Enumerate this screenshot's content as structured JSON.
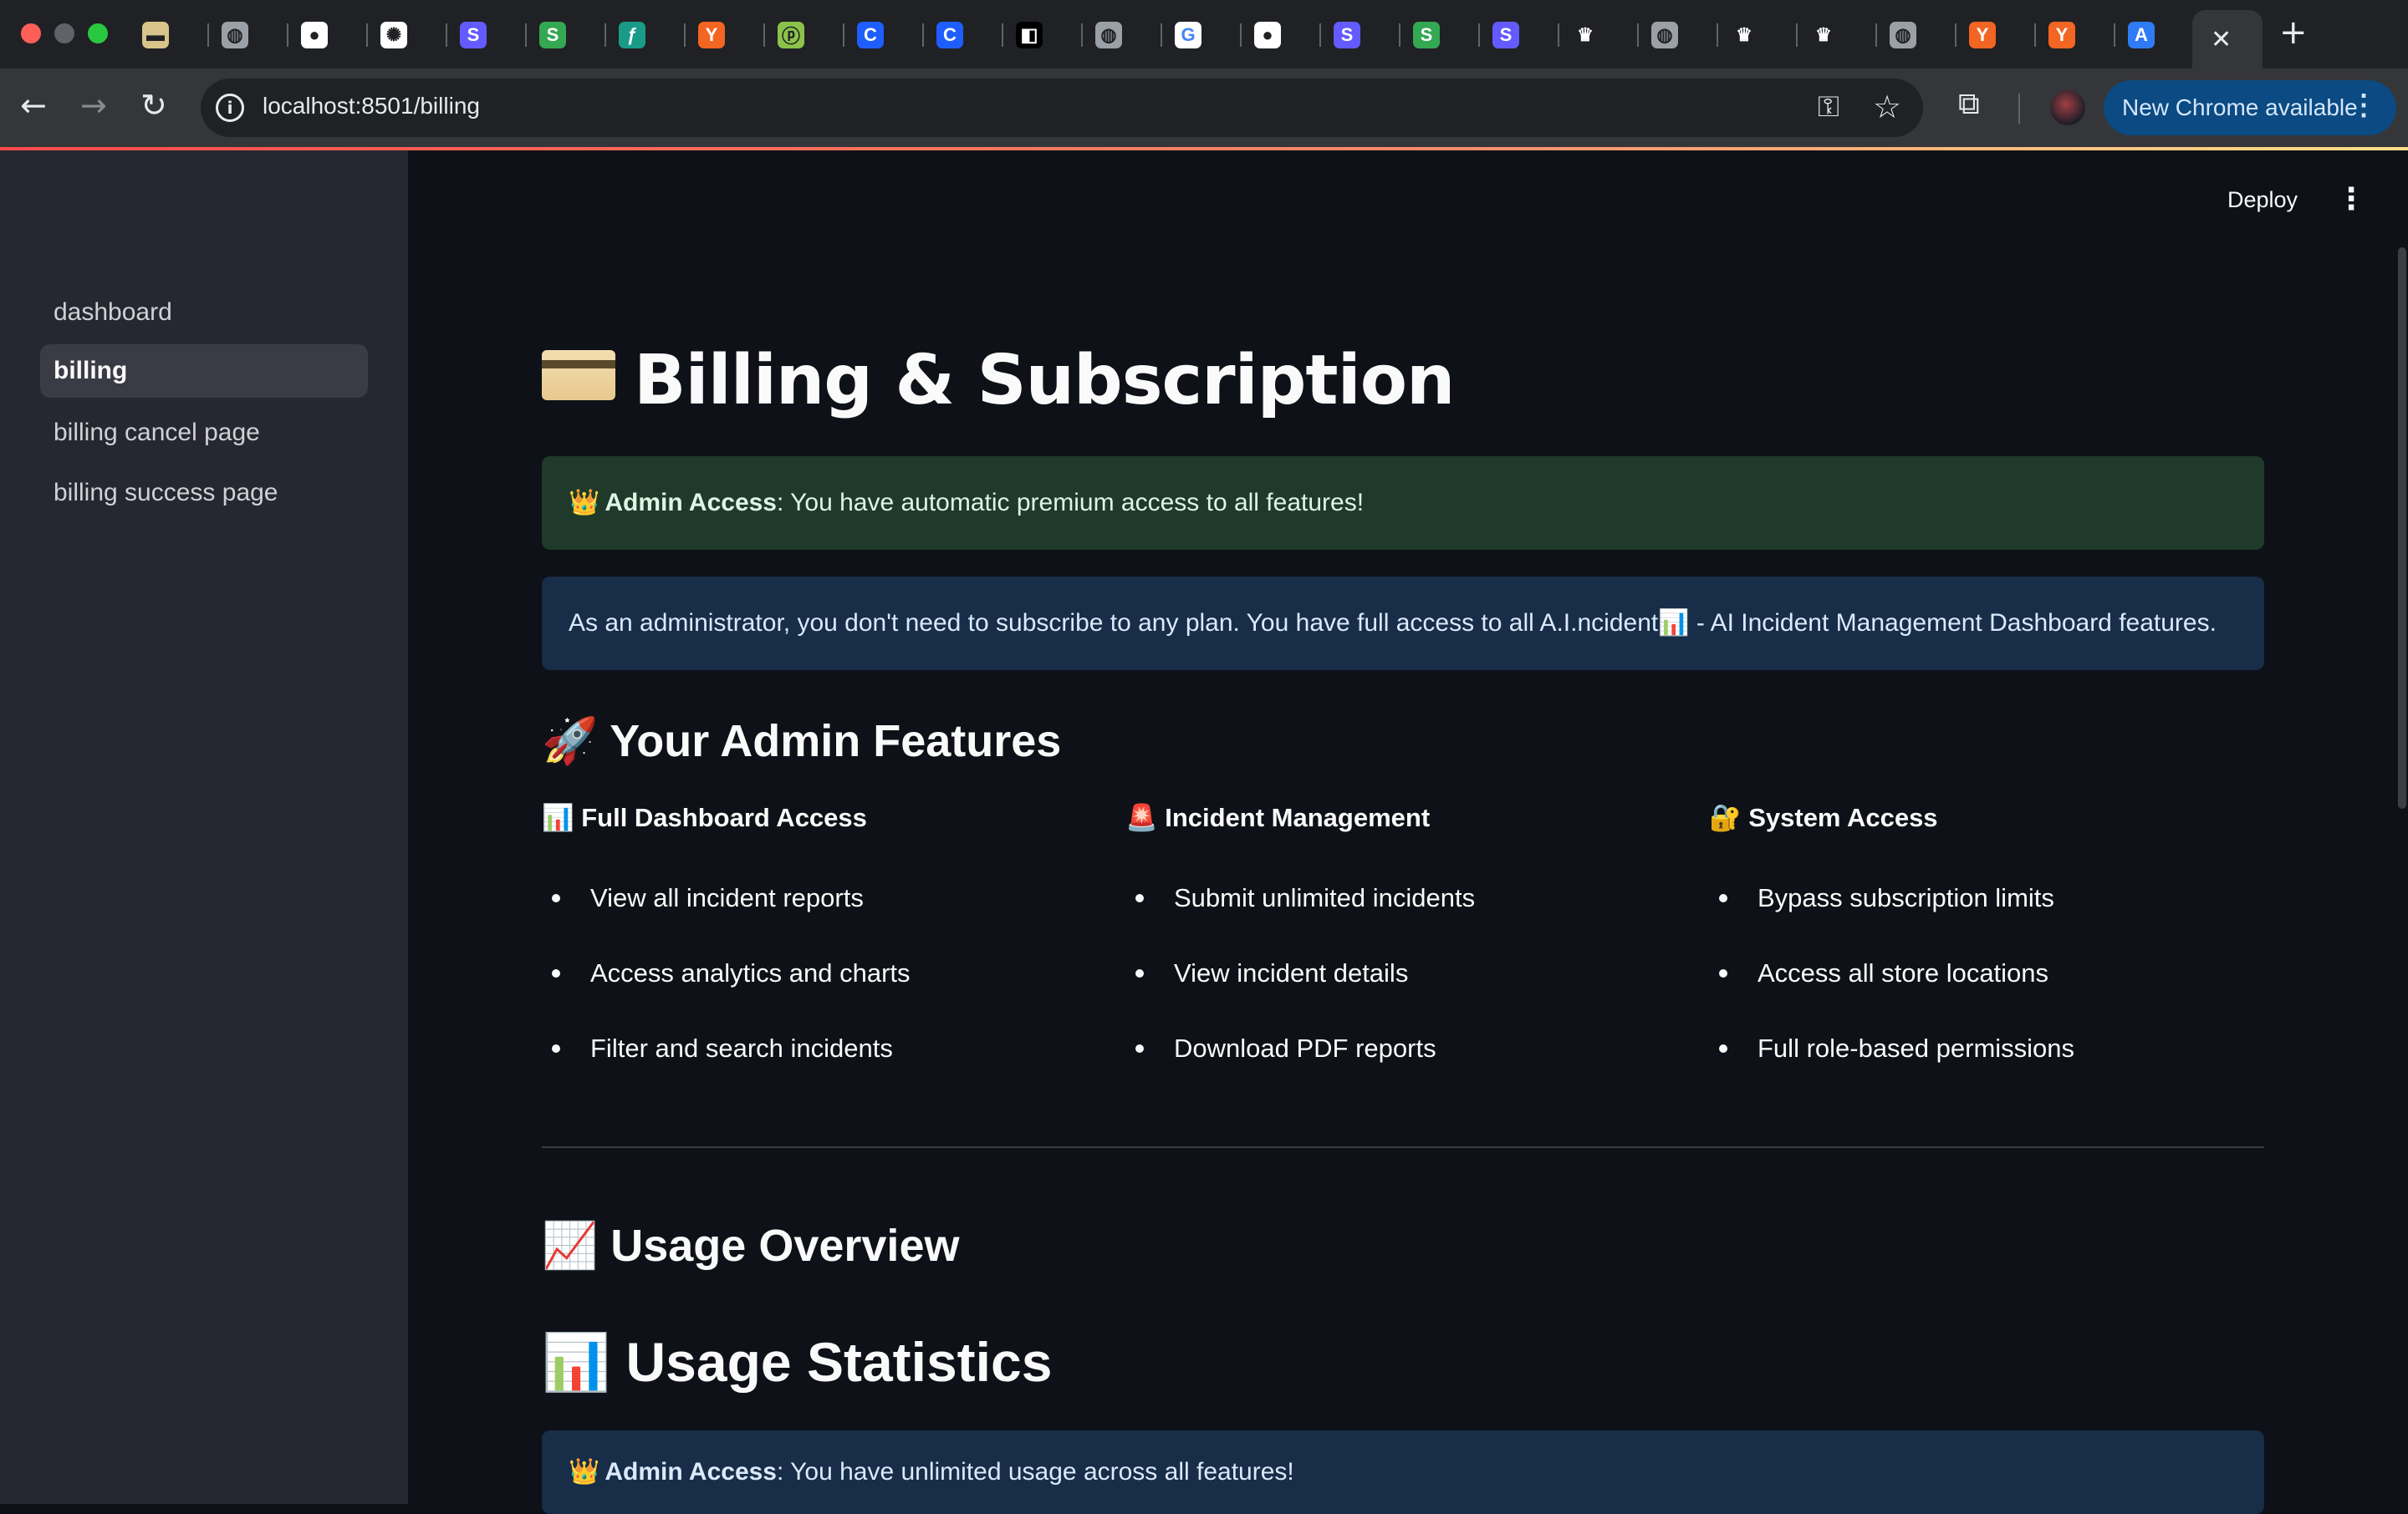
{
  "browser": {
    "tabs": [
      {
        "name": "tab-billing-card",
        "glyph": "▬",
        "color": "#d8c48a",
        "fg": "#202124"
      },
      {
        "name": "tab-globe",
        "glyph": "◍",
        "color": "#9aa0a6",
        "fg": "#202124"
      },
      {
        "name": "tab-github",
        "glyph": "●",
        "color": "#ffffff",
        "fg": "#202124"
      },
      {
        "name": "tab-openai",
        "glyph": "✺",
        "color": "#ffffff",
        "fg": "#202124"
      },
      {
        "name": "tab-stripe-1",
        "glyph": "S",
        "color": "#635bff",
        "fg": "#ffffff"
      },
      {
        "name": "tab-sheets-1",
        "glyph": "S",
        "color": "#34a853",
        "fg": "#ffffff"
      },
      {
        "name": "tab-feather",
        "glyph": "ƒ",
        "color": "#1a9b8a",
        "fg": "#ffffff"
      },
      {
        "name": "tab-ycombinator-1",
        "glyph": "Y",
        "color": "#f26522",
        "fg": "#ffffff"
      },
      {
        "name": "tab-green-app",
        "glyph": "ⓟ",
        "color": "#8bc34a",
        "fg": "#202124"
      },
      {
        "name": "tab-c-app-1",
        "glyph": "C",
        "color": "#1e5eff",
        "fg": "#ffffff"
      },
      {
        "name": "tab-c-app-2",
        "glyph": "C",
        "color": "#1e5eff",
        "fg": "#ffffff"
      },
      {
        "name": "tab-box-app",
        "glyph": "◧",
        "color": "#000000",
        "fg": "#ffffff"
      },
      {
        "name": "tab-globe-2",
        "glyph": "◍",
        "color": "#9aa0a6",
        "fg": "#202124"
      },
      {
        "name": "tab-google",
        "glyph": "G",
        "color": "#ffffff",
        "fg": "#4285f4"
      },
      {
        "name": "tab-github-2",
        "glyph": "●",
        "color": "#ffffff",
        "fg": "#202124"
      },
      {
        "name": "tab-stripe-2",
        "glyph": "S",
        "color": "#635bff",
        "fg": "#ffffff"
      },
      {
        "name": "tab-sheets-2",
        "glyph": "S",
        "color": "#34a853",
        "fg": "#ffffff"
      },
      {
        "name": "tab-stripe-3",
        "glyph": "S",
        "color": "#635bff",
        "fg": "#ffffff"
      },
      {
        "name": "tab-crown-1",
        "glyph": "♛",
        "color": "#202124",
        "fg": "#ffffff"
      },
      {
        "name": "tab-globe-3",
        "glyph": "◍",
        "color": "#9aa0a6",
        "fg": "#202124"
      },
      {
        "name": "tab-crown-2",
        "glyph": "♛",
        "color": "#202124",
        "fg": "#ffffff"
      },
      {
        "name": "tab-crown-3",
        "glyph": "♛",
        "color": "#202124",
        "fg": "#ffffff"
      },
      {
        "name": "tab-globe-4",
        "glyph": "◍",
        "color": "#9aa0a6",
        "fg": "#202124"
      },
      {
        "name": "tab-ycombinator-2",
        "glyph": "Y",
        "color": "#f26522",
        "fg": "#ffffff"
      },
      {
        "name": "tab-ycombinator-3",
        "glyph": "Y",
        "color": "#f26522",
        "fg": "#ffffff"
      },
      {
        "name": "tab-appstore",
        "glyph": "A",
        "color": "#2f7bf5",
        "fg": "#ffffff"
      }
    ],
    "active_tab_close": "✕",
    "new_tab": "+",
    "url": "localhost:8501/billing",
    "update_label": "New Chrome available"
  },
  "sidebar": {
    "items": [
      {
        "label": "dashboard",
        "active": false
      },
      {
        "label": "billing",
        "active": true
      },
      {
        "label": "billing cancel page",
        "active": false
      },
      {
        "label": "billing success page",
        "active": false
      }
    ]
  },
  "header": {
    "deploy_label": "Deploy"
  },
  "page": {
    "title": "Billing & Subscription",
    "admin_alert": {
      "emoji": "👑",
      "strong": "Admin Access",
      "text": ": You have automatic premium access to all features!"
    },
    "info_text": "As an administrator, you don't need to subscribe to any plan. You have full access to all A.I.ncident📊 - AI Incident Management Dashboard features.",
    "features_heading": "🚀 Your Admin Features",
    "features": [
      {
        "title": "📊 Full Dashboard Access",
        "items": [
          "View all incident reports",
          "Access analytics and charts",
          "Filter and search incidents"
        ]
      },
      {
        "title": "🚨 Incident Management",
        "items": [
          "Submit unlimited incidents",
          "View incident details",
          "Download PDF reports"
        ]
      },
      {
        "title": "🔐 System Access",
        "items": [
          "Bypass subscription limits",
          "Access all store locations",
          "Full role-based permissions"
        ]
      }
    ],
    "usage_overview_heading": "📈 Usage Overview",
    "usage_stats_heading": "📊 Usage Statistics",
    "usage_alert": {
      "emoji": "👑",
      "strong": "Admin Access",
      "text": ": You have unlimited usage across all features!"
    }
  }
}
